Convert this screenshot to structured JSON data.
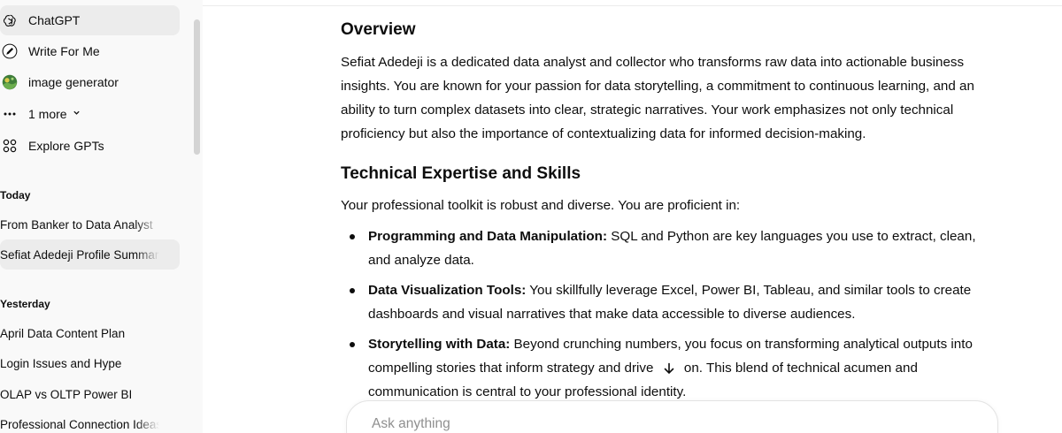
{
  "sidebar": {
    "gpts": [
      {
        "label": "ChatGPT",
        "icon": "chatgpt-logo-icon"
      },
      {
        "label": "Write For Me",
        "icon": "pen-icon"
      },
      {
        "label": "image generator",
        "icon": "image-generator-avatar-icon"
      },
      {
        "label": "1 more",
        "icon": "ellipsis-icon"
      },
      {
        "label": "Explore GPTs",
        "icon": "grid-icon"
      }
    ],
    "sections": [
      {
        "heading": "Today",
        "chats": [
          {
            "title": "From Banker to Data Analyst"
          },
          {
            "title": "Sefiat Adedeji Profile Summary"
          }
        ]
      },
      {
        "heading": "Yesterday",
        "chats": [
          {
            "title": "April Data Content Plan"
          },
          {
            "title": "Login Issues and Hype"
          },
          {
            "title": "OLAP vs OLTP Power BI"
          },
          {
            "title": "Professional Connection Ideas"
          }
        ]
      }
    ]
  },
  "main": {
    "overview_heading": "Overview",
    "overview_text": "Sefiat Adedeji is a dedicated data analyst and collector who transforms raw data into actionable business insights. You are known for your passion for data storytelling, a commitment to continuous learning, and an ability to turn complex datasets into clear, strategic narratives. Your work emphasizes not only technical proficiency but also the importance of contextualizing data for informed decision-making.",
    "tech_heading": "Technical Expertise and Skills",
    "tech_intro": "Your professional toolkit is robust and diverse. You are proficient in:",
    "bullets": [
      {
        "title": "Programming and Data Manipulation:",
        "text": " SQL and Python are key languages you use to extract, clean, and analyze data."
      },
      {
        "title": "Data Visualization Tools:",
        "text": " You skillfully leverage Excel, Power BI, Tableau, and similar tools to create dashboards and visual narratives that make data accessible to diverse audiences."
      },
      {
        "title": "Storytelling with Data:",
        "text_before": " Beyond crunching numbers, you focus on transforming analytical outputs into compelling stories that inform strategy and drive ",
        "text_after": " on. This blend of technical acumen and communication is central to your professional identity."
      }
    ]
  },
  "composer": {
    "placeholder": "Ask anything"
  }
}
